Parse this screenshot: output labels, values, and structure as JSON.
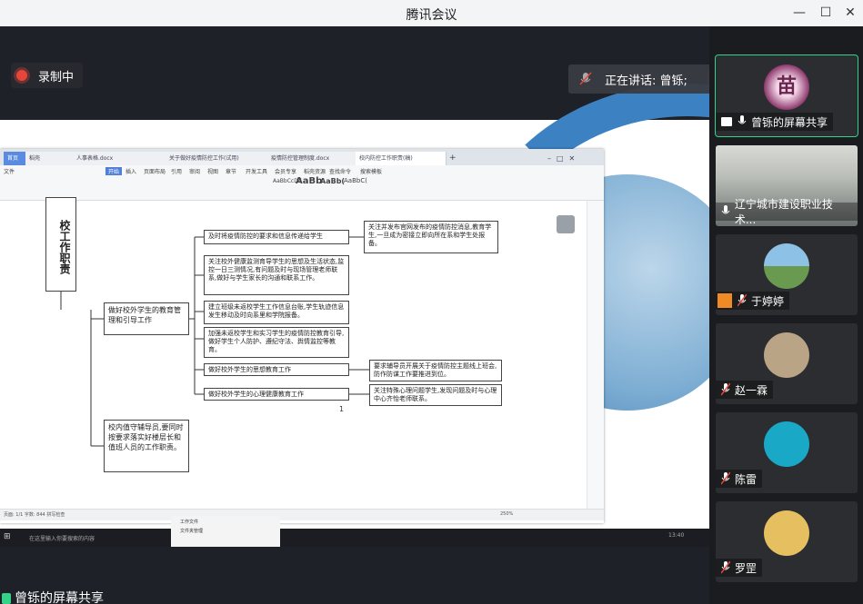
{
  "window": {
    "title": "腾讯会议",
    "minimize": "—",
    "maximize": "☐",
    "close": "✕"
  },
  "recording": {
    "label": "录制中"
  },
  "speaking": {
    "label": "正在讲话: 曾铄;"
  },
  "bottom_caption": "曾铄的屏幕共享",
  "document": {
    "tabs": [
      "首页",
      "稻壳",
      "人事表格.docx",
      "关于做好疫情防控工作(试用)",
      "疫情防控管理制度.docx",
      "校内防控工作职责(稿)"
    ],
    "ribbon_tabs": [
      "文件",
      "开始",
      "插入",
      "页面布局",
      "引用",
      "审阅",
      "视图",
      "章节",
      "开发工具",
      "会员专享",
      "稻壳资源",
      "查找命令",
      "搜索模板"
    ],
    "styles": [
      "AaBbCcDd",
      "AaBb",
      "AaBb(",
      "AaBbC("
    ],
    "vertical_title": "校工作职责",
    "page_number": "1",
    "nodes": {
      "n1": "及时将疫情防控的要求和信息传递给学生",
      "n1_note": "关注并发布官网发布的疫情防控消息,教育学生,一旦成为密接立即向所在系和学生处报备。",
      "n2": "关注校外健康监测育导学生的思想及生活状态,监控一日三测情况,有问题及时与现场管理老师联系,做好与学生家长的沟通和联系工作。",
      "n3": "建立班级未返校学生工作信息台账,学生轨迹信息发生移动及时向系里和学院报备。",
      "n4": "加强未返校学生和实习学生的疫情防控教育引导,做好学生个人防护、遵纪守法、舆情监控等教育。",
      "main": "做好校外学生的教育管理和引导工作",
      "n5": "做好校外学生的思想教育工作",
      "n5_note": "要求辅导员开展关于疫情防控主题线上班会,防作防谋工作要推进到位。",
      "n6": "做好校外学生的心理健康教育工作",
      "n6_note": "关注特殊心理问题学生,发现问题及时与心理中心齐怡老师联系。",
      "n7": "校内值守辅导员,要同时按要求落实好楼层长和值班人员的工作职责。"
    },
    "status_left": "页面: 1/1  字数: 844  拼写检查",
    "zoom": "250%"
  },
  "taskbar": {
    "search_placeholder": "在这里输入你要搜索的内容",
    "folder1": "工作文件",
    "folder2": "文件夹管理",
    "time": "13:40"
  },
  "participants": [
    {
      "name": "曾铄的屏幕共享",
      "avatar_text": "苗",
      "color": "#8e3a6e"
    },
    {
      "name": "辽宁城市建设职业技术...",
      "color": "#7d8a8c"
    },
    {
      "name": "于婷婷",
      "color": "#4e8fc0"
    },
    {
      "name": "赵一霖",
      "color": "#b9a486"
    },
    {
      "name": "陈雷",
      "color": "#19a9c6"
    },
    {
      "name": "罗罡",
      "color": "#e6c060"
    }
  ]
}
